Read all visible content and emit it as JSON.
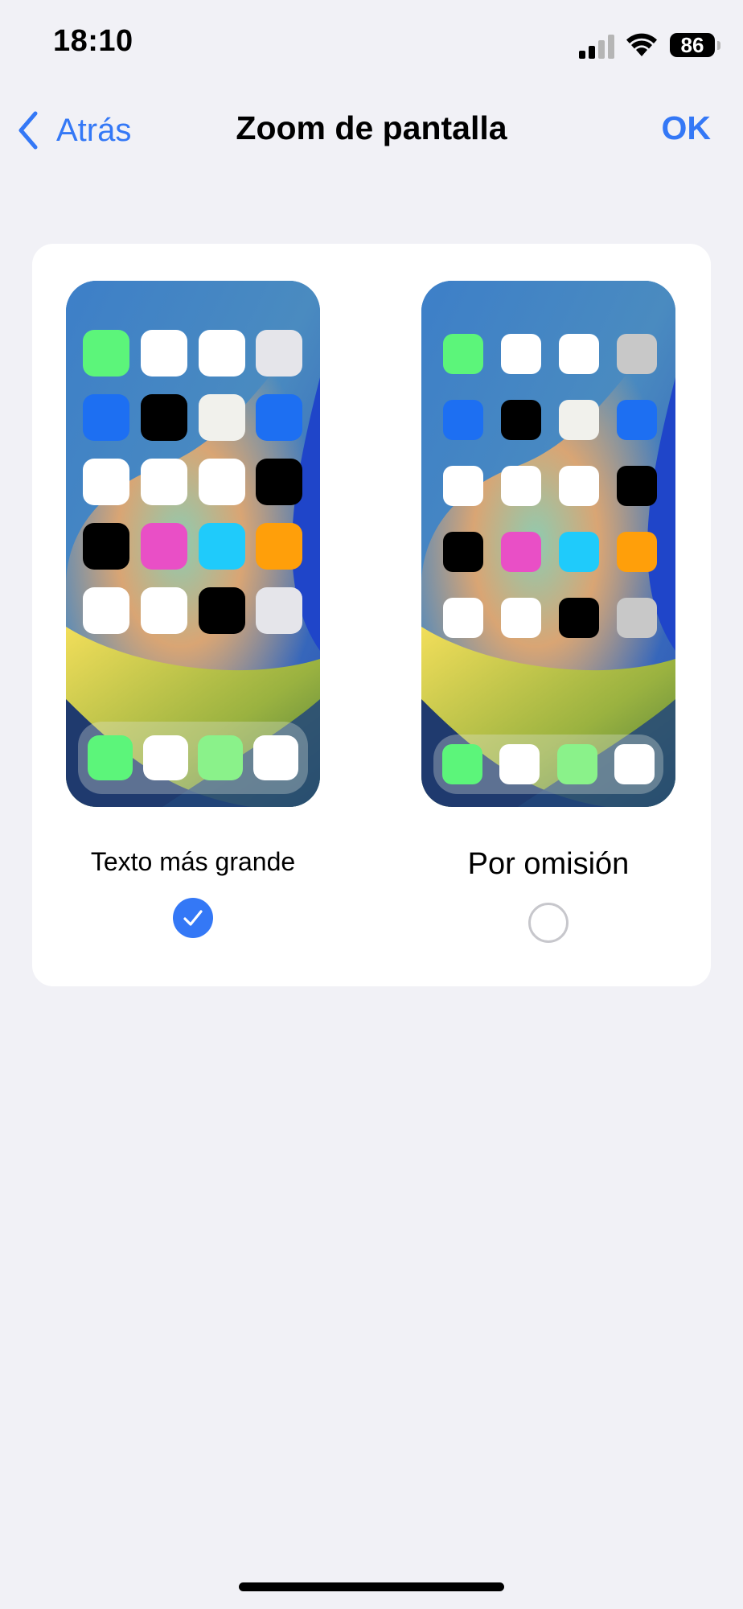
{
  "status_bar": {
    "time": "18:10",
    "battery_level": "86",
    "signal_icon": "cellular-signal-icon",
    "wifi_icon": "wifi-icon"
  },
  "nav": {
    "back_label": "Atrás",
    "back_icon": "chevron-left-icon",
    "title": "Zoom de pantalla",
    "done_label": "OK"
  },
  "colors": {
    "accent": "#3478f6",
    "background": "#f1f1f6",
    "card": "#ffffff"
  },
  "options": [
    {
      "label": "Texto más grande",
      "selected": true,
      "preview_icons": [
        "#5cf57a",
        "#ffffff",
        "#ffffff",
        "#e5e5ea",
        "#1d6ff2",
        "#000000",
        "#f1f1ec",
        "#1d6ff2",
        "#ffffff",
        "#ffffff",
        "#ffffff",
        "#000000",
        "#000000",
        "#e94fc6",
        "#1fcbfb",
        "#ff9f0a",
        "#ffffff",
        "#ffffff",
        "#000000",
        "#e5e5ea"
      ],
      "dock_icons": [
        "#5cf57a",
        "#ffffff",
        "#8af28a",
        "#ffffff"
      ]
    },
    {
      "label": "Por omisión",
      "selected": false,
      "preview_icons": [
        "#5cf57a",
        "#ffffff",
        "#ffffff",
        "#c8c8c8",
        "#1d6ff2",
        "#000000",
        "#f1f1ec",
        "#1d6ff2",
        "#ffffff",
        "#ffffff",
        "#ffffff",
        "#000000",
        "#000000",
        "#e94fc6",
        "#1fcbfb",
        "#ff9f0a",
        "#ffffff",
        "#ffffff",
        "#000000",
        "#c8c8c8"
      ],
      "dock_icons": [
        "#5cf57a",
        "#ffffff",
        "#8af28a",
        "#ffffff"
      ]
    }
  ]
}
